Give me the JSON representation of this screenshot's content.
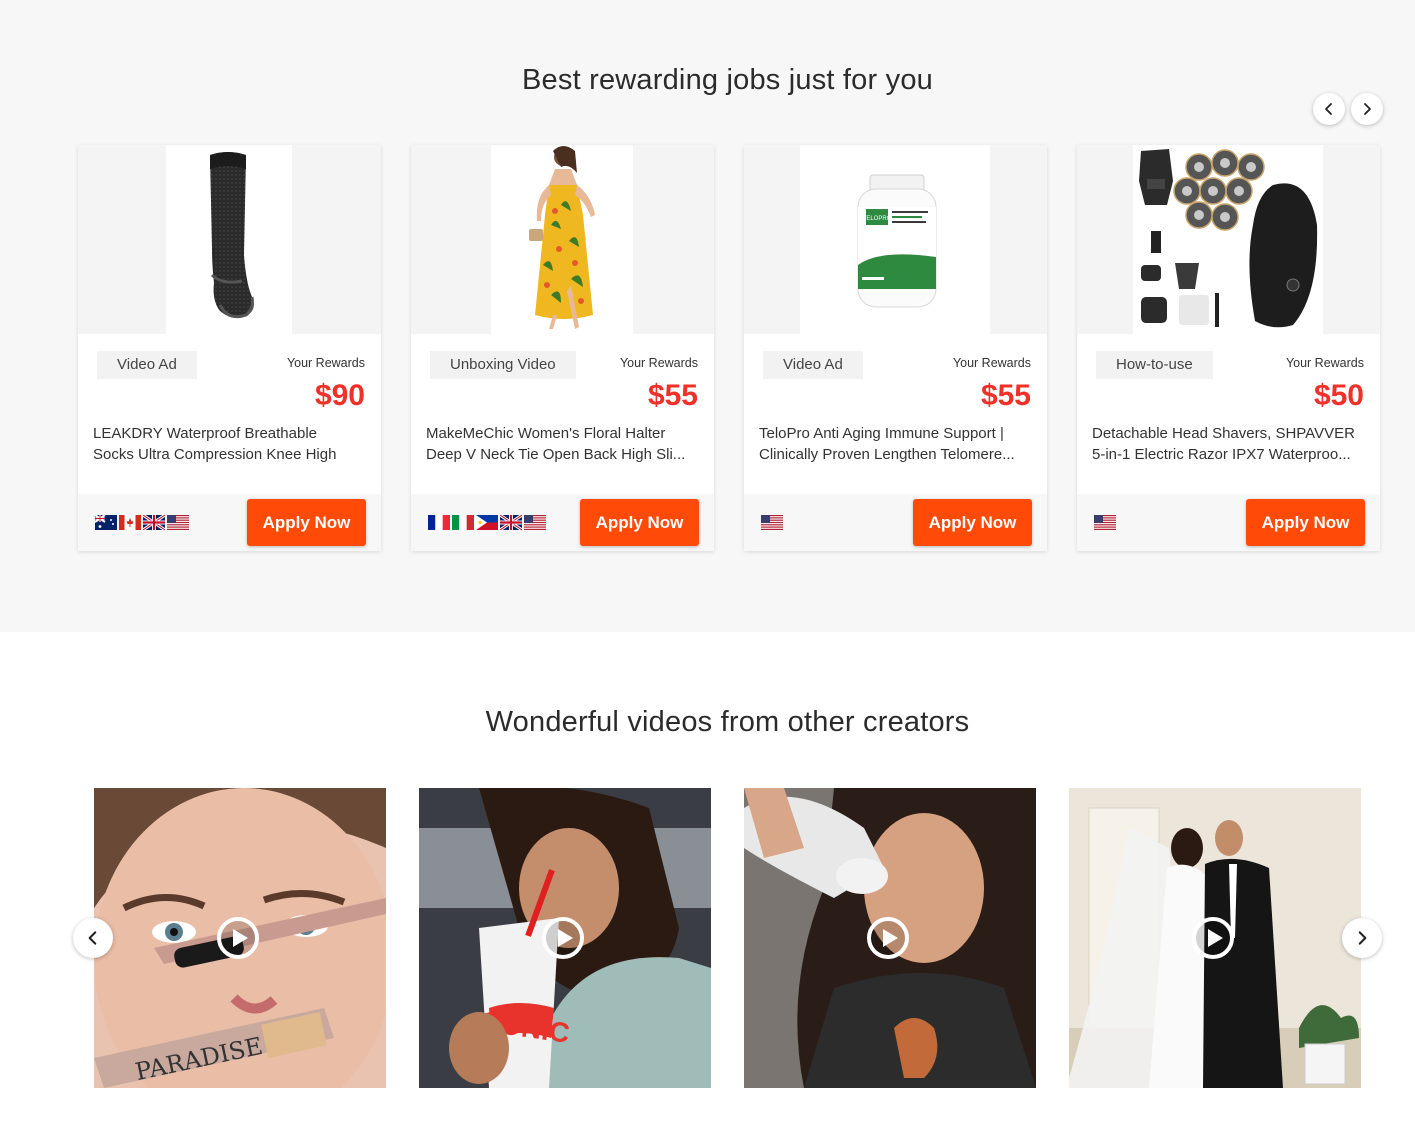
{
  "jobs_section": {
    "title": "Best rewarding jobs just for you",
    "cards": [
      {
        "type": "Video Ad",
        "rewards_label": "Your Rewards",
        "reward": "$90",
        "desc_line1": "LEAKDRY Waterproof Breathable",
        "desc_line2": "Socks Ultra Compression Knee High",
        "flags": [
          "flag-au-icon",
          "flag-ca-icon",
          "flag-uk-icon",
          "flag-us-icon"
        ],
        "apply_label": "Apply Now"
      },
      {
        "type": "Unboxing Video",
        "rewards_label": "Your Rewards",
        "reward": "$55",
        "desc_line1": "MakeMeChic Women's Floral Halter",
        "desc_line2": "Deep V Neck Tie Open Back High Sli...",
        "flags": [
          "flag-fr-icon",
          "flag-it-icon",
          "flag-ph-icon",
          "flag-uk-icon",
          "flag-us-icon"
        ],
        "apply_label": "Apply Now"
      },
      {
        "type": "Video Ad",
        "rewards_label": "Your Rewards",
        "reward": "$55",
        "desc_line1": "TeloPro Anti Aging Immune Support |",
        "desc_line2": "Clinically Proven Lengthen Telomere...",
        "flags": [
          "flag-us-icon"
        ],
        "apply_label": "Apply Now",
        "bottle_brand": "TELOPRO"
      },
      {
        "type": "How-to-use",
        "rewards_label": "Your Rewards",
        "reward": "$50",
        "desc_line1": "Detachable Head Shavers, SHPAVVER",
        "desc_line2": "5-in-1 Electric Razor IPX7 Waterproo...",
        "flags": [
          "flag-us-icon"
        ],
        "apply_label": "Apply Now"
      }
    ]
  },
  "videos_section": {
    "title": "Wonderful videos from other creators",
    "videos": [
      {
        "subject": "mascara application",
        "product_text": "PARADISE"
      },
      {
        "subject": "drinking from cup",
        "product_text": "SONIC"
      },
      {
        "subject": "drinking from bottle"
      },
      {
        "subject": "wedding couple"
      }
    ]
  },
  "colors": {
    "accent": "#ff4a08",
    "reward": "#f0312a",
    "section_bg": "#f7f7f7"
  }
}
